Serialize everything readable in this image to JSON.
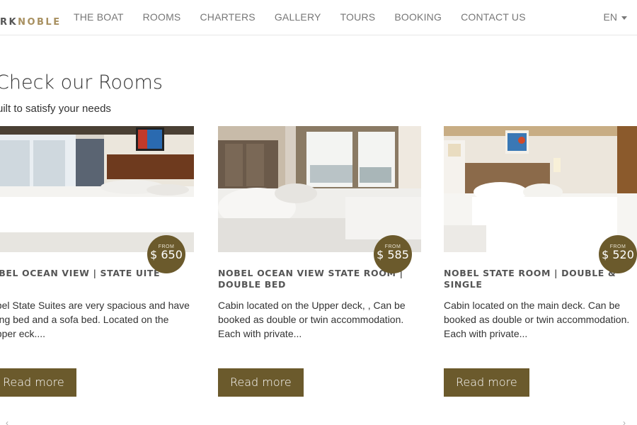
{
  "nav": {
    "logo_prefix": "RK",
    "logo_main": "NOBLE",
    "items": [
      "THE BOAT",
      "ROOMS",
      "CHARTERS",
      "GALLERY",
      "TOURS",
      "BOOKING",
      "CONTACT US"
    ],
    "language": "EN"
  },
  "section": {
    "title": "Check our Rooms",
    "subtitle": "uilt to satisfy your needs"
  },
  "cards": [
    {
      "from_label": "FROM",
      "price": "$ 650",
      "title": "OBEL OCEAN VIEW | STATE UITE",
      "description": "obel State Suites are very spacious and have a ng bed and a sofa bed. Located on the upper eck....",
      "button": "Read more"
    },
    {
      "from_label": "FROM",
      "price": "$ 585",
      "title": "NOBEL OCEAN VIEW STATE ROOM | DOUBLE BED",
      "description": "Cabin located on the Upper deck, , Can be booked as double or twin accommodation. Each with private...",
      "button": "Read more"
    },
    {
      "from_label": "FROM",
      "price": "$ 520",
      "title": "NOBEL STATE ROOM | DOUBLE & SINGLE",
      "description": "Cabin located on the main deck. Can be booked as double or twin accommodation. Each with private...",
      "button": "Read more"
    }
  ],
  "colors": {
    "accent": "#6b5a2c",
    "logo_gold": "#a89060",
    "nav_text": "#777777"
  }
}
